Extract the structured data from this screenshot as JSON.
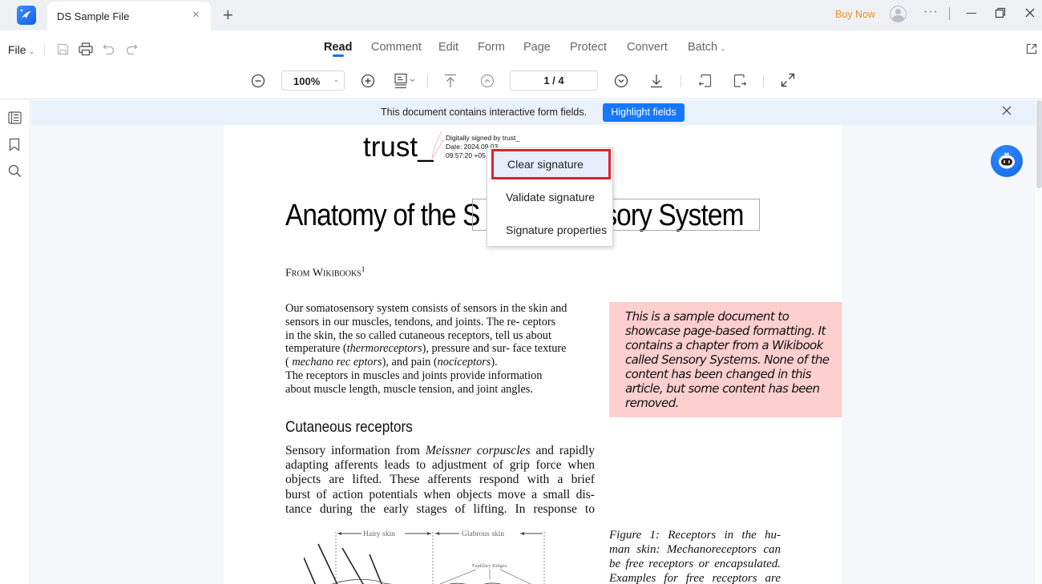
{
  "titlebar": {
    "tab_title": "DS Sample File",
    "tab_close": "×",
    "new_tab": "+",
    "buy_now": "Buy Now",
    "more": "···",
    "colors": {
      "buy_now": "#e8912d",
      "logo": "#1a6fe8"
    }
  },
  "menubar": {
    "file_label": "File",
    "file_chevron": "⌄",
    "tabs": [
      {
        "label": "Read",
        "active": true
      },
      {
        "label": "Comment",
        "active": false
      },
      {
        "label": "Edit",
        "active": false
      },
      {
        "label": "Form",
        "active": false
      },
      {
        "label": "Page",
        "active": false
      },
      {
        "label": "Protect",
        "active": false
      },
      {
        "label": "Convert",
        "active": false
      },
      {
        "label": "Batch",
        "active": false
      }
    ],
    "batch_chevron": "⌄",
    "quick_icons": [
      "save-icon",
      "print-icon",
      "undo-icon",
      "redo-icon"
    ],
    "export_icon": "open-external-icon"
  },
  "toolbar": {
    "zoom_value": "100%",
    "zoom_chevron": "⌄",
    "page_current": "1",
    "page_total": "4",
    "page_display": "1  / 4",
    "icons": [
      "zoom-out-icon",
      "zoom-in-icon",
      "reading-mode-icon",
      "first-page-icon",
      "previous-page-icon",
      "next-page-icon",
      "last-page-icon",
      "rotate-left-icon",
      "rotate-right-icon",
      "fullscreen-icon"
    ]
  },
  "sidebar": {
    "items": [
      {
        "name": "thumbnails",
        "icon": "thumbnails-icon"
      },
      {
        "name": "bookmarks",
        "icon": "bookmark-icon"
      },
      {
        "name": "search",
        "icon": "search-icon"
      }
    ]
  },
  "notice": {
    "text": "This document contains interactive form fields.",
    "button": "Highlight fields",
    "colors": {
      "bar": "#e9f1fc",
      "button": "#1677ff"
    }
  },
  "document": {
    "signature": {
      "name": "trust_",
      "line1": "Digitally signed by trust_",
      "line2": "Date: 2024.09.03",
      "line3": "09:57:20 +05"
    },
    "title_left": "Anatomy of the S",
    "title_right": "sory System",
    "from": "From Wikibooks",
    "from_sup": "1",
    "intro_lines": [
      "Our somatosensory system consists of  sensors in the skin  and",
      "sensors in our  muscles, tendons, and  joints. The re- ceptors",
      "in the skin, the so  called cutaneous receptors,  tell  us about",
      [
        "temperature (",
        "thermoreceptors",
        "),  pressure and sur- face  texture"
      ],
      [
        "( ",
        "mechano  rec  eptors",
        "),  and  pain  (",
        "nociceptors",
        ")."
      ],
      "The receptors in muscles and joints provide  information",
      "about muscle length, muscle   tension, and joint angles."
    ],
    "sidebox": "This is a sample document to showcase page-based formatting. It contains a chapter from a Wikibook called Sensory Systems. None of the content has been changed in this article, but some content has been removed.",
    "section_heading": "Cutaneous receptors",
    "section_lines": [
      [
        "Sensory information from ",
        "Meissner corpuscles",
        " and rapidly"
      ],
      "adapting afferents leads to adjustment of grip force when",
      "objects are lifted. These afferents respond with a brief",
      "burst of action potentials when objects move a small dis-",
      "tance during the early stages of lifting. In response to"
    ],
    "figure": {
      "label_hairy": "Hairy skin",
      "label_glabrous": "Glabrous skin",
      "label_ridges": "Papillary Ridges"
    },
    "caption_lines": [
      "Figure 1:   Receptors in the hu-",
      "man skin: Mechanoreceptors can",
      "be free receptors or encapsulated.",
      "Examples  for  free  receptors  are"
    ],
    "colors": {
      "sidebox": "#fdcfcf"
    }
  },
  "context_menu": {
    "items": [
      {
        "label": "Clear signature",
        "highlighted": true
      },
      {
        "label": "Validate signature",
        "highlighted": false
      },
      {
        "label": "Signature properties",
        "highlighted": false
      }
    ],
    "colors": {
      "highlight_border": "#d9242f",
      "highlight_bg": "#e6eefc"
    }
  },
  "assistant": {
    "icon": "ai-assistant-robot-icon"
  }
}
